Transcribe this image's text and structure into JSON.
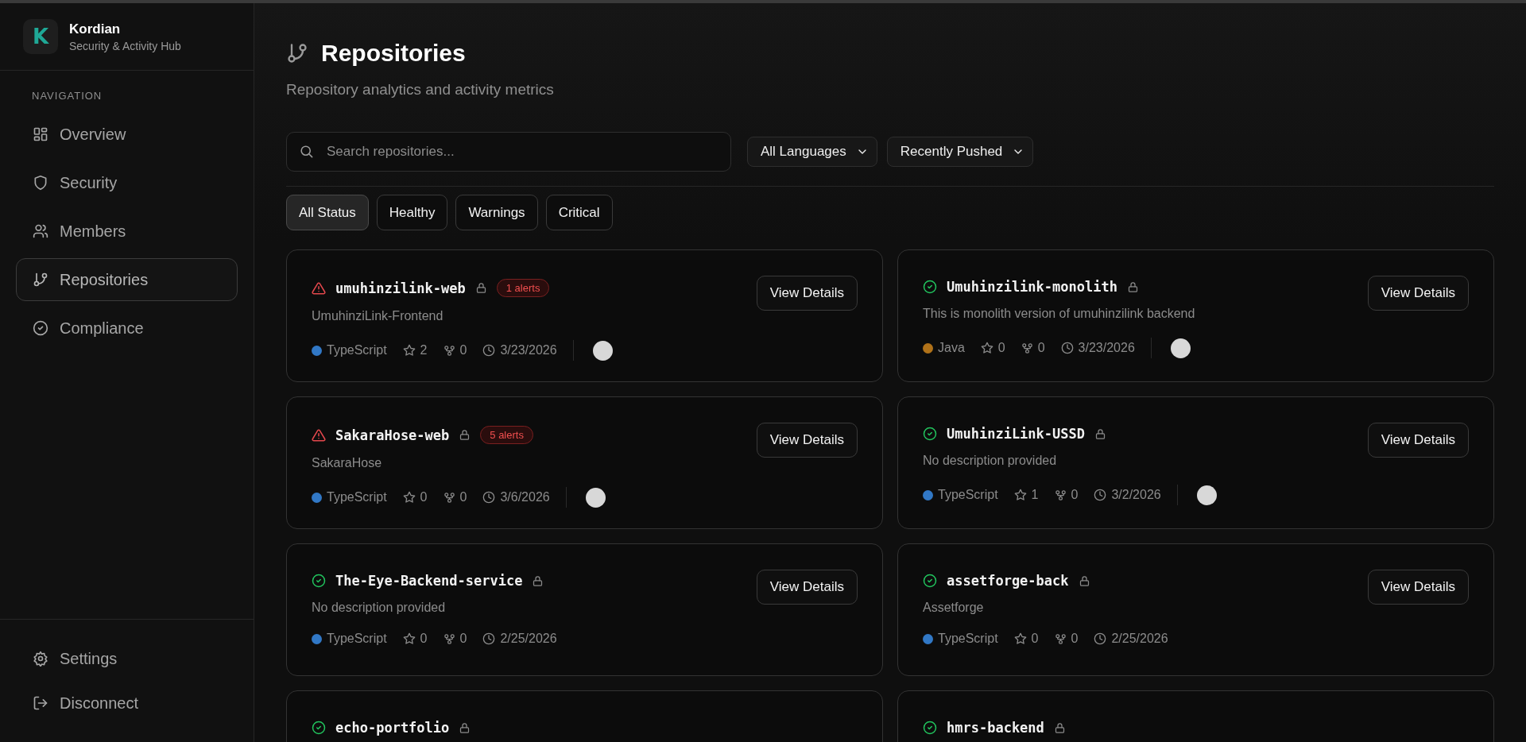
{
  "brand": {
    "logo_letter": "K",
    "name": "Kordian",
    "tagline": "Security & Activity Hub"
  },
  "sidebar": {
    "section_label": "NAVIGATION",
    "items": [
      {
        "label": "Overview",
        "selected": false
      },
      {
        "label": "Security",
        "selected": false
      },
      {
        "label": "Members",
        "selected": false
      },
      {
        "label": "Repositories",
        "selected": true
      },
      {
        "label": "Compliance",
        "selected": false
      }
    ],
    "footer_items": [
      {
        "label": "Settings"
      },
      {
        "label": "Disconnect"
      }
    ]
  },
  "page": {
    "title": "Repositories",
    "subtitle": "Repository analytics and activity metrics"
  },
  "search": {
    "placeholder": "Search repositories..."
  },
  "dropdowns": [
    {
      "value": "All Languages"
    },
    {
      "value": "Recently Pushed"
    }
  ],
  "status_filters": [
    {
      "label": "All Status",
      "selected": true
    },
    {
      "label": "Healthy",
      "selected": false
    },
    {
      "label": "Warnings",
      "selected": false
    },
    {
      "label": "Critical",
      "selected": false
    }
  ],
  "repositories": [
    {
      "name": "umuhinzilink-web",
      "kind": "warning",
      "private": true,
      "alerts": "1 alerts",
      "description": "UmuhinziLink-Frontend",
      "language": "TypeScript",
      "color": "#3178c6",
      "star_count": "2",
      "fork_count": "0",
      "pushed": "3/23/2026",
      "avatar": true,
      "action": "View Details"
    },
    {
      "name": "Umuhinzilink-monolith",
      "kind": "healthy",
      "private": true,
      "description": "This is monolith version of umuhinzilink backend",
      "language": "Java",
      "color": "#b07219",
      "star_count": "0",
      "fork_count": "0",
      "pushed": "3/23/2026",
      "avatar": true,
      "action": "View Details"
    },
    {
      "name": "SakaraHose-web",
      "kind": "warning",
      "private": true,
      "alerts": "5 alerts",
      "description": "SakaraHose",
      "language": "TypeScript",
      "color": "#3178c6",
      "star_count": "0",
      "fork_count": "0",
      "pushed": "3/6/2026",
      "avatar": true,
      "action": "View Details"
    },
    {
      "name": "UmuhinziLink-USSD",
      "kind": "healthy",
      "private": true,
      "description": "No description provided",
      "language": "TypeScript",
      "color": "#3178c6",
      "star_count": "1",
      "fork_count": "0",
      "pushed": "3/2/2026",
      "avatar": true,
      "action": "View Details"
    },
    {
      "name": "The-Eye-Backend-service",
      "kind": "healthy",
      "private": true,
      "description": "No description provided",
      "language": "TypeScript",
      "color": "#3178c6",
      "star_count": "0",
      "fork_count": "0",
      "pushed": "2/25/2026",
      "avatar": false,
      "action": "View Details"
    },
    {
      "name": "assetforge-back",
      "kind": "healthy",
      "private": true,
      "description": "Assetforge",
      "language": "TypeScript",
      "color": "#3178c6",
      "star_count": "0",
      "fork_count": "0",
      "pushed": "2/25/2026",
      "avatar": false,
      "action": "View Details"
    },
    {
      "name": "echo-portfolio",
      "kind": "healthy",
      "private": true
    },
    {
      "name": "hmrs-backend",
      "kind": "healthy",
      "private": true
    }
  ]
}
